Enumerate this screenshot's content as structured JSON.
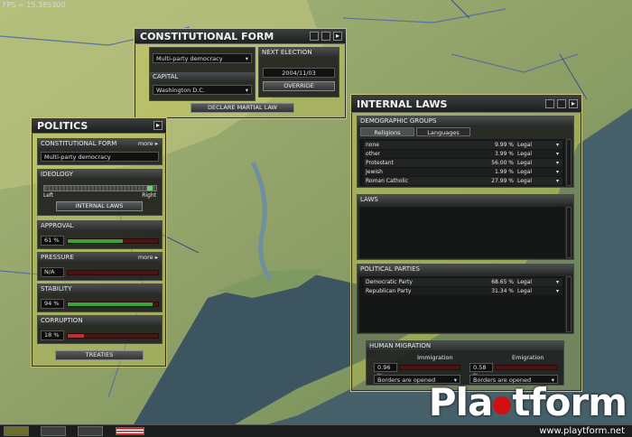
{
  "fps": "FPS = 15.385300",
  "constitutional": {
    "title": "CONSTITUTIONAL FORM",
    "form_value": "Multi-party democracy",
    "capital_label": "CAPITAL",
    "capital_value": "Washington D.C.",
    "next_election_label": "NEXT ELECTION",
    "next_election_date": "2004/11/03",
    "override_label": "OVERRIDE",
    "martial_law_label": "DECLARE MARTIAL LAW"
  },
  "politics": {
    "title": "POLITICS",
    "constitutional_label": "CONSTITUTIONAL FORM",
    "more_label": "more",
    "constitutional_value": "Multi-party democracy",
    "ideology_label": "IDEOLOGY",
    "ideology_left": "Left",
    "ideology_right": "Right",
    "ideology_position": 0.97,
    "internal_laws_button": "INTERNAL LAWS",
    "approval_label": "APPROVAL",
    "approval_pct": "61 %",
    "approval_value": 0.61,
    "pressure_label": "PRESSURE",
    "pressure_more": "more",
    "pressure_pct": "N/A",
    "stability_label": "STABILITY",
    "stability_pct": "94 %",
    "stability_value": 0.94,
    "corruption_label": "CORRUPTION",
    "corruption_pct": "18 %",
    "corruption_value": 0.18,
    "treaties_label": "TREATIES",
    "colors": {
      "approval": "#3aa33a",
      "stability": "#3aa33a",
      "corruption": "#c03030"
    }
  },
  "internal_laws": {
    "title": "INTERNAL LAWS",
    "demographic_label": "DEMOGRAPHIC GROUPS",
    "tab_religions": "Religions",
    "tab_languages": "Languages",
    "religions": [
      {
        "name": "none",
        "pct": "9.99 %",
        "status": "Legal"
      },
      {
        "name": "other",
        "pct": "3.99 %",
        "status": "Legal"
      },
      {
        "name": "Protestant",
        "pct": "56.00 %",
        "status": "Legal"
      },
      {
        "name": "Jewish",
        "pct": "1.99 %",
        "status": "Legal"
      },
      {
        "name": "Roman Catholic",
        "pct": "27.99 %",
        "status": "Legal"
      }
    ],
    "laws_label": "LAWS",
    "parties_label": "POLITICAL PARTIES",
    "parties": [
      {
        "name": "Democratic Party",
        "pct": "68.65 %",
        "status": "Legal"
      },
      {
        "name": "Republican Party",
        "pct": "31.34 %",
        "status": "Legal"
      }
    ],
    "migration_label": "HUMAN MIGRATION",
    "immigration_label": "Immigration",
    "immigration_pct": "0.96 %",
    "immigration_value": "Borders are opened",
    "emigration_label": "Emigration",
    "emigration_pct": "0.58 %",
    "emigration_value": "Borders are opened"
  },
  "logo": {
    "text_before": "Pla",
    "text_after": "tform",
    "url": "www.playtform.net"
  }
}
